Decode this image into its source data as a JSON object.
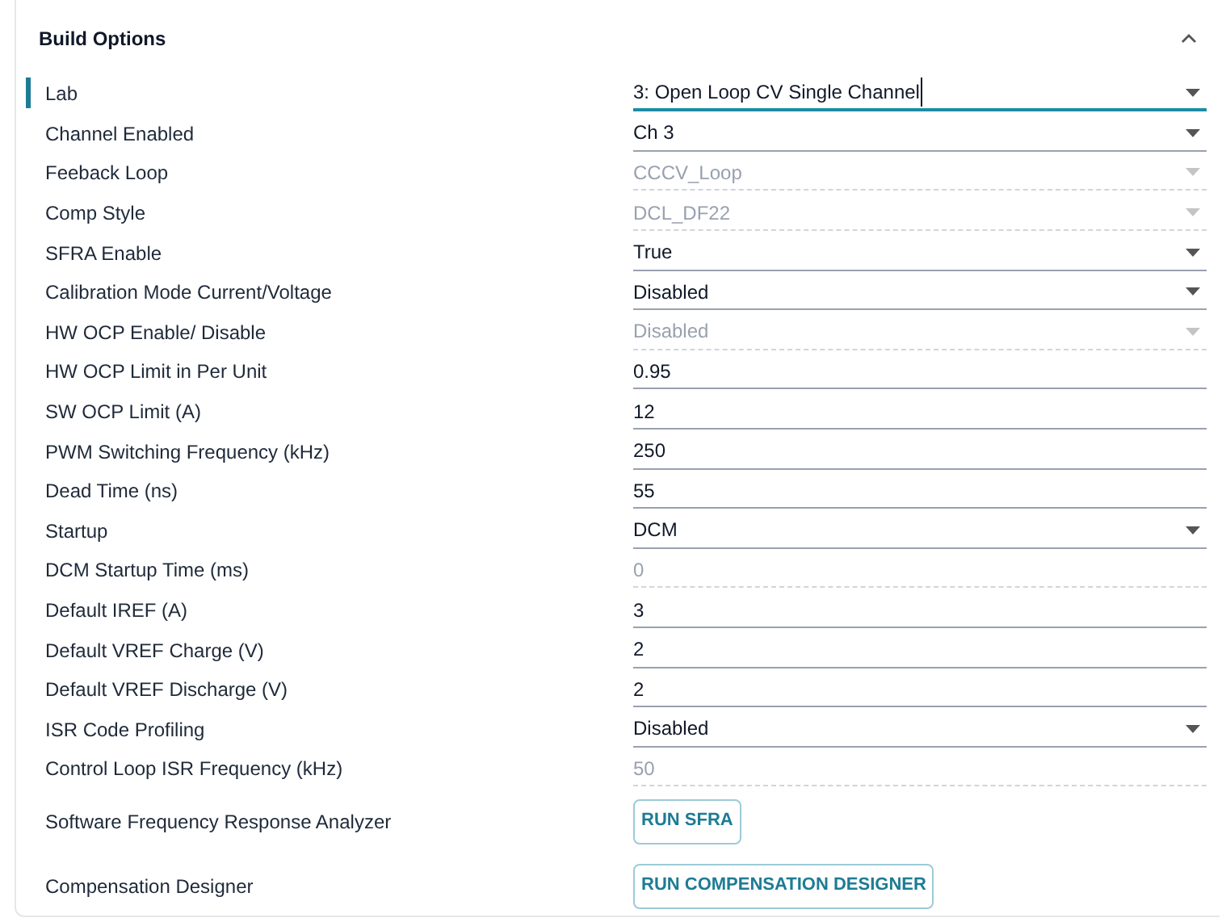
{
  "section": {
    "title": "Build Options",
    "expanded": true
  },
  "rows": [
    {
      "label": "Lab",
      "kind": "select",
      "value": "3: Open Loop CV Single Channel",
      "disabled": false,
      "focused": true
    },
    {
      "label": "Channel Enabled",
      "kind": "select",
      "value": "Ch 3",
      "disabled": false,
      "focused": false
    },
    {
      "label": "Feeback Loop",
      "kind": "select",
      "value": "CCCV_Loop",
      "disabled": true,
      "focused": false
    },
    {
      "label": "Comp Style",
      "kind": "select",
      "value": "DCL_DF22",
      "disabled": true,
      "focused": false
    },
    {
      "label": "SFRA Enable",
      "kind": "select",
      "value": "True",
      "disabled": false,
      "focused": false
    },
    {
      "label": "Calibration Mode Current/Voltage",
      "kind": "select",
      "value": "Disabled",
      "disabled": false,
      "focused": false
    },
    {
      "label": "HW OCP Enable/ Disable",
      "kind": "select",
      "value": "Disabled",
      "disabled": true,
      "focused": false
    },
    {
      "label": "HW OCP Limit in Per Unit",
      "kind": "text",
      "value": "0.95",
      "disabled": false,
      "focused": false
    },
    {
      "label": "SW OCP Limit (A)",
      "kind": "text",
      "value": "12",
      "disabled": false,
      "focused": false
    },
    {
      "label": "PWM Switching Frequency (kHz)",
      "kind": "text",
      "value": "250",
      "disabled": false,
      "focused": false
    },
    {
      "label": "Dead Time (ns)",
      "kind": "text",
      "value": "55",
      "disabled": false,
      "focused": false
    },
    {
      "label": "Startup",
      "kind": "select",
      "value": "DCM",
      "disabled": false,
      "focused": false
    },
    {
      "label": "DCM Startup Time (ms)",
      "kind": "text",
      "value": "0",
      "disabled": true,
      "focused": false
    },
    {
      "label": "Default IREF (A)",
      "kind": "text",
      "value": "3",
      "disabled": false,
      "focused": false
    },
    {
      "label": "Default VREF Charge (V)",
      "kind": "text",
      "value": "2",
      "disabled": false,
      "focused": false
    },
    {
      "label": "Default VREF Discharge (V)",
      "kind": "text",
      "value": "2",
      "disabled": false,
      "focused": false
    },
    {
      "label": "ISR Code Profiling",
      "kind": "select",
      "value": "Disabled",
      "disabled": false,
      "focused": false
    },
    {
      "label": "Control Loop ISR Frequency (kHz)",
      "kind": "text",
      "value": "50",
      "disabled": true,
      "focused": false
    },
    {
      "label": "Software Frequency Response Analyzer",
      "kind": "button",
      "value": "RUN SFRA"
    },
    {
      "label": "Compensation Designer",
      "kind": "button",
      "value": "RUN COMPENSATION DESIGNER"
    }
  ]
}
